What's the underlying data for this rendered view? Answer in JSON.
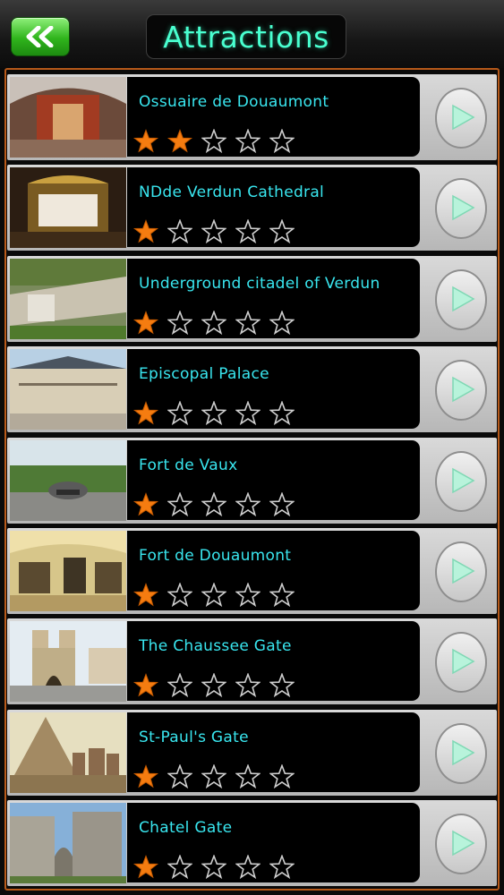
{
  "header": {
    "title": "Attractions",
    "back_icon": "double-chevron-left-icon"
  },
  "colors": {
    "title": "#49ffd0",
    "item_name": "#39e6ef",
    "star_filled": "#f57c10",
    "frame": "#b85a1a"
  },
  "attractions": [
    {
      "name": "Ossuaire de Douaumont",
      "rating": 2
    },
    {
      "name": "NDde Verdun Cathedral",
      "rating": 1
    },
    {
      "name": "Underground citadel of Verdun",
      "rating": 1
    },
    {
      "name": "Episcopal Palace",
      "rating": 1
    },
    {
      "name": "Fort de Vaux",
      "rating": 1
    },
    {
      "name": "Fort de Douaumont",
      "rating": 1
    },
    {
      "name": "The Chaussee Gate",
      "rating": 1
    },
    {
      "name": "St-Paul's Gate",
      "rating": 1
    },
    {
      "name": "Chatel Gate",
      "rating": 1
    }
  ],
  "rating_max": 5
}
